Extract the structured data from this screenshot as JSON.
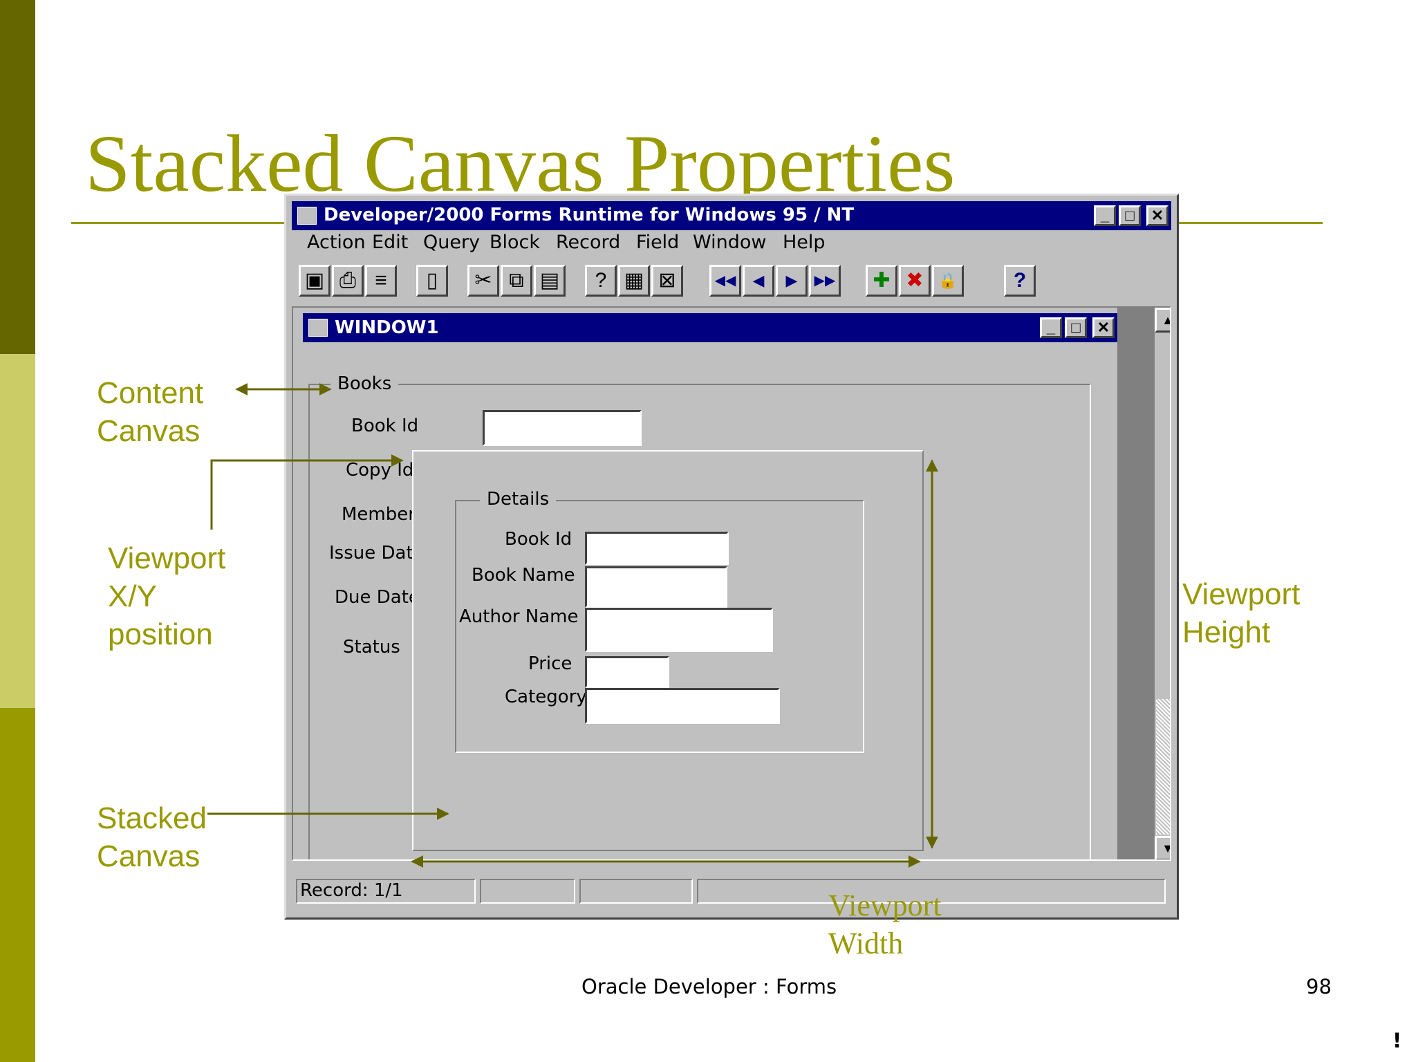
{
  "slide": {
    "title": "Stacked Canvas Properties",
    "footer_text": "Oracle Developer : Forms",
    "page_number": "98",
    "corner_mark": "!",
    "accent_color": "#999900",
    "stripe_colors": [
      "#666600",
      "#cccc66",
      "#999900"
    ]
  },
  "callouts": {
    "content_canvas": [
      "Content",
      "Canvas"
    ],
    "viewport_xy": [
      "Viewport",
      "X/Y",
      "position"
    ],
    "stacked_canvas": [
      "Stacked",
      "Canvas"
    ],
    "viewport_height": [
      "Viewport",
      "Height"
    ],
    "viewport_width": [
      "Viewport",
      "Width"
    ]
  },
  "app": {
    "title": "Developer/2000 Forms Runtime for Windows 95 / NT",
    "window_buttons": [
      "_",
      "□",
      "✕"
    ],
    "menu": [
      {
        "label": "Action"
      },
      {
        "label": "Edit"
      },
      {
        "label": "Query"
      },
      {
        "label": "Block"
      },
      {
        "label": "Record"
      },
      {
        "label": "Field"
      },
      {
        "label": "Window"
      },
      {
        "label": "Help"
      }
    ],
    "toolbar": [
      {
        "icon": "save-icon",
        "glyph": "▣"
      },
      {
        "icon": "print-icon",
        "glyph": "⎙"
      },
      {
        "icon": "print-setup-icon",
        "glyph": "≡"
      },
      {
        "icon": "exit-icon",
        "glyph": "▯"
      },
      {
        "icon": "cut-icon",
        "glyph": "✂"
      },
      {
        "icon": "copy-icon",
        "glyph": "⧉"
      },
      {
        "icon": "paste-icon",
        "glyph": "▤"
      },
      {
        "icon": "enter-query-icon",
        "glyph": "?"
      },
      {
        "icon": "execute-query-icon",
        "glyph": "▦"
      },
      {
        "icon": "cancel-query-icon",
        "glyph": "⊠"
      },
      {
        "icon": "first-record-icon",
        "glyph": "◀◀"
      },
      {
        "icon": "previous-record-icon",
        "glyph": "◀"
      },
      {
        "icon": "next-record-icon",
        "glyph": "▶"
      },
      {
        "icon": "last-record-icon",
        "glyph": "▶▶"
      },
      {
        "icon": "insert-record-icon",
        "glyph": "✚"
      },
      {
        "icon": "remove-record-icon",
        "glyph": "✖"
      },
      {
        "icon": "lock-record-icon",
        "glyph": "🔒"
      },
      {
        "icon": "help-icon",
        "glyph": "?"
      }
    ],
    "inner_window": {
      "title": "WINDOW1"
    },
    "books_frame": {
      "title": "Books",
      "labels": {
        "book_id": "Book Id",
        "copy_id": "Copy Id",
        "member": "Member",
        "issue_date": "Issue Date",
        "due_date": "Due Date",
        "status": "Status"
      }
    },
    "details_frame": {
      "title": "Details",
      "labels": {
        "book_id": "Book Id",
        "book_name": "Book Name",
        "author_name": "Author Name",
        "price": "Price",
        "category": "Category"
      }
    },
    "statusbar": {
      "record": "Record: 1/1"
    }
  }
}
